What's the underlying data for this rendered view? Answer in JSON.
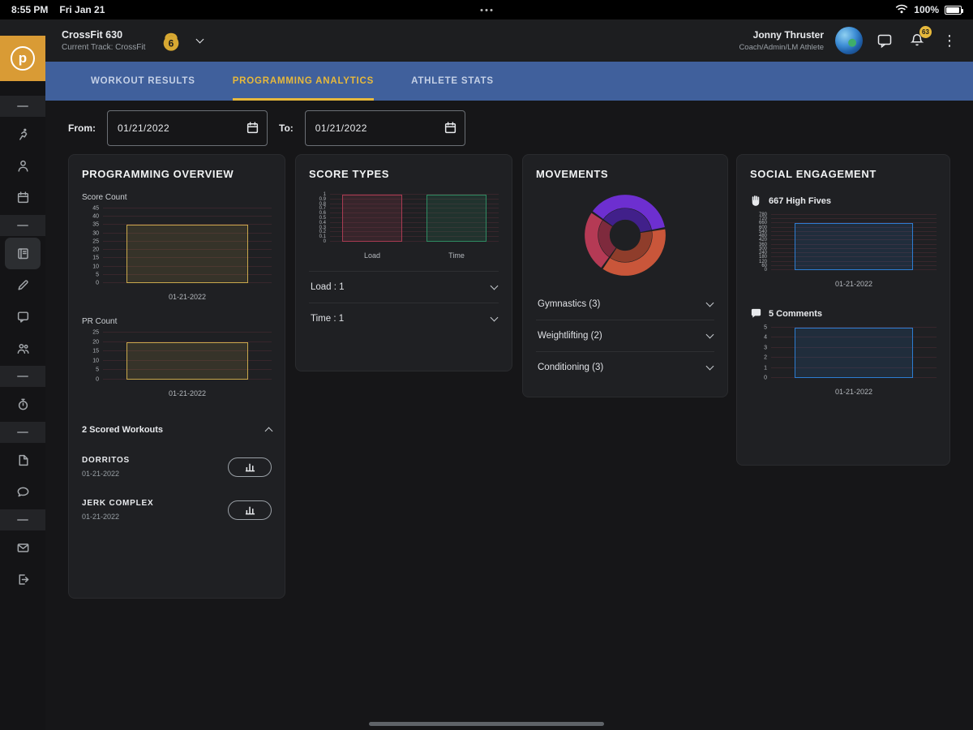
{
  "status_bar": {
    "time": "8:55 PM",
    "date": "Fri Jan 21",
    "battery": "100%"
  },
  "header": {
    "app_logo_letter": "p",
    "gym_name": "CrossFit 630",
    "track_label": "Current Track: CrossFit",
    "gym_logo_text": "6",
    "user_name": "Jonny Thruster",
    "user_roles": "Coach/Admin/LM Athlete",
    "notification_badge": "63"
  },
  "icons": {
    "overflow_menu": "⋮"
  },
  "tabs": [
    {
      "label": "WORKOUT RESULTS",
      "active": false
    },
    {
      "label": "PROGRAMMING ANALYTICS",
      "active": true
    },
    {
      "label": "ATHLETE STATS",
      "active": false
    }
  ],
  "sidebar": {
    "items": [
      "section-divider",
      "runner",
      "person",
      "calendar",
      "section-divider",
      "journal",
      "pencil",
      "comment",
      "people",
      "section-divider",
      "timer",
      "section-divider",
      "document",
      "chat",
      "section-divider",
      "mail",
      "sign-out"
    ]
  },
  "filters": {
    "from_label": "From:",
    "from_value": "01/21/2022",
    "to_label": "To:",
    "to_value": "01/21/2022"
  },
  "cards": {
    "programming_overview": {
      "title": "PROGRAMMING OVERVIEW",
      "score_count_label": "Score Count",
      "pr_count_label": "PR Count",
      "scored_workouts_label": "2 Scored Workouts",
      "workouts": [
        {
          "name": "DORRITOS",
          "date": "01-21-2022"
        },
        {
          "name": "JERK COMPLEX",
          "date": "01-21-2022"
        }
      ]
    },
    "score_types": {
      "title": "SCORE TYPES",
      "rows": [
        {
          "label": "Load : 1"
        },
        {
          "label": "Time : 1"
        }
      ]
    },
    "movements": {
      "title": "MOVEMENTS",
      "items": [
        {
          "label": "Gymnastics (3)"
        },
        {
          "label": "Weightlifting (2)"
        },
        {
          "label": "Conditioning (3)"
        }
      ]
    },
    "social_engagement": {
      "title": "SOCIAL ENGAGEMENT",
      "high_fives_label": "667 High Fives",
      "comments_label": "5 Comments"
    }
  },
  "colors": {
    "accent_gold": "#e7b93c",
    "tab_bar_blue": "#40609c",
    "bar_gold": "#c9a84c",
    "bar_red": "#a93b52",
    "bar_green": "#2f8c63",
    "bar_blue": "#2d7dd2"
  },
  "chart_data": [
    {
      "id": "score_count",
      "type": "bar",
      "title": "Score Count",
      "categories": [
        "01-21-2022"
      ],
      "values": [
        35
      ],
      "ylim": [
        0,
        45
      ],
      "yticks": [
        0,
        5,
        10,
        15,
        20,
        25,
        30,
        35,
        40,
        45
      ],
      "border": "#c9a84c",
      "fill": "rgba(201,168,76,0.14)",
      "height": 92
    },
    {
      "id": "pr_count",
      "type": "bar",
      "title": "PR Count",
      "categories": [
        "01-21-2022"
      ],
      "values": [
        20
      ],
      "ylim": [
        0,
        25
      ],
      "yticks": [
        0,
        5,
        10,
        15,
        20,
        25
      ],
      "border": "#c9a84c",
      "fill": "rgba(201,168,76,0.14)",
      "height": 58
    },
    {
      "id": "score_types",
      "type": "bar",
      "title": "Score Types",
      "categories": [
        "Load",
        "Time"
      ],
      "values": [
        1,
        1
      ],
      "ylim": [
        0,
        1
      ],
      "yticks": [
        0,
        0.1,
        0.2,
        0.3,
        0.4,
        0.5,
        0.6,
        0.7,
        0.8,
        0.9,
        1
      ],
      "border": [
        "#a93b52",
        "#2f8c63"
      ],
      "fill": [
        "rgba(169,59,82,0.18)",
        "rgba(47,140,99,0.18)"
      ],
      "height": 58,
      "tick_size": 6
    },
    {
      "id": "movements",
      "type": "donut",
      "title": "Movements",
      "start_angle": -55,
      "segments": [
        {
          "label": "Gymnastics",
          "value": 3,
          "color": "#6d2fd0",
          "inner_color": "#41208a"
        },
        {
          "label": "Conditioning",
          "value": 3,
          "color": "#c9563a",
          "inner_color": "#8f3d2b"
        },
        {
          "label": "Weightlifting",
          "value": 2,
          "color": "#b53a55",
          "inner_color": "#7e2a3d"
        }
      ]
    },
    {
      "id": "high_fives",
      "type": "bar",
      "title": "High Fives",
      "categories": [
        "01-21-2022"
      ],
      "values": [
        667
      ],
      "ylim": [
        0,
        780
      ],
      "yticks": [
        0,
        60,
        120,
        180,
        240,
        300,
        360,
        420,
        480,
        540,
        600,
        660,
        720,
        780
      ],
      "border": "#2d7dd2",
      "fill": "rgba(45,125,210,0.14)",
      "height": 68,
      "tick_size": 6
    },
    {
      "id": "comments",
      "type": "bar",
      "title": "Comments",
      "categories": [
        "01-21-2022"
      ],
      "values": [
        5
      ],
      "ylim": [
        0,
        5
      ],
      "yticks": [
        0,
        1,
        2,
        3,
        4,
        5
      ],
      "border": "#2d7dd2",
      "fill": "rgba(45,125,210,0.14)",
      "height": 62
    }
  ]
}
